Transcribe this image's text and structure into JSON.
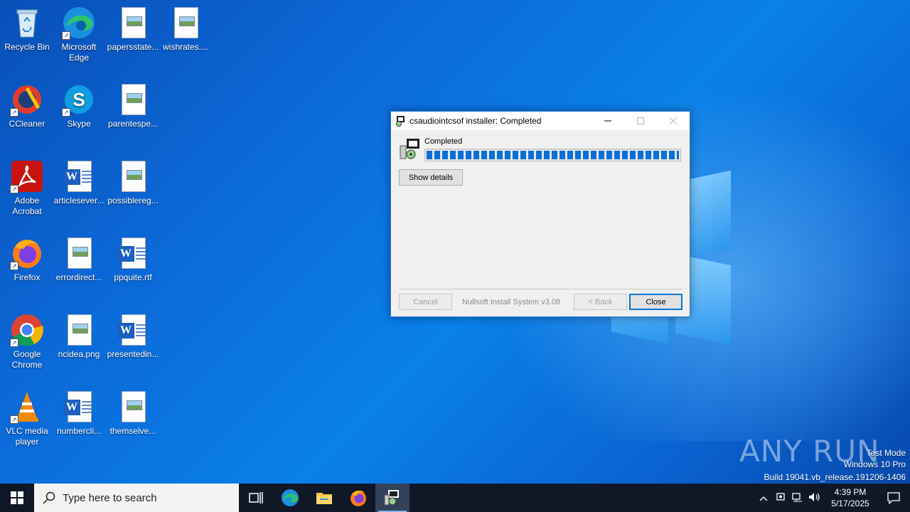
{
  "desktop": {
    "icons": [
      {
        "label": "Recycle Bin"
      },
      {
        "label": "Microsoft Edge"
      },
      {
        "label": "papersstate..."
      },
      {
        "label": "wishrates...."
      },
      {
        "label": "CCleaner"
      },
      {
        "label": "Skype"
      },
      {
        "label": "parentespe..."
      },
      {
        "label": "Adobe Acrobat"
      },
      {
        "label": "articlesever..."
      },
      {
        "label": "possiblereg..."
      },
      {
        "label": "Firefox"
      },
      {
        "label": "errordirect..."
      },
      {
        "label": "ppquite.rtf"
      },
      {
        "label": "Google Chrome"
      },
      {
        "label": "ncidea.png"
      },
      {
        "label": "presentedin..."
      },
      {
        "label": "VLC media player"
      },
      {
        "label": "numbercli..."
      },
      {
        "label": "themselve..."
      }
    ]
  },
  "dialog": {
    "title": "csaudiointcsof installer: Completed",
    "status": "Completed",
    "progress": 1.0,
    "show_details": "Show details",
    "cancel": "Cancel",
    "branding": "Nullsoft Install System v3.08",
    "back": "< Back",
    "close": "Close"
  },
  "watermark": {
    "logo": "ANY RUN",
    "line1": "Test Mode",
    "line2": "Windows 10 Pro",
    "line3": "Build 19041.vb_release.191206-1406"
  },
  "taskbar": {
    "search_placeholder": "Type here to search",
    "time": "4:39 PM",
    "date": "5/17/2025"
  }
}
